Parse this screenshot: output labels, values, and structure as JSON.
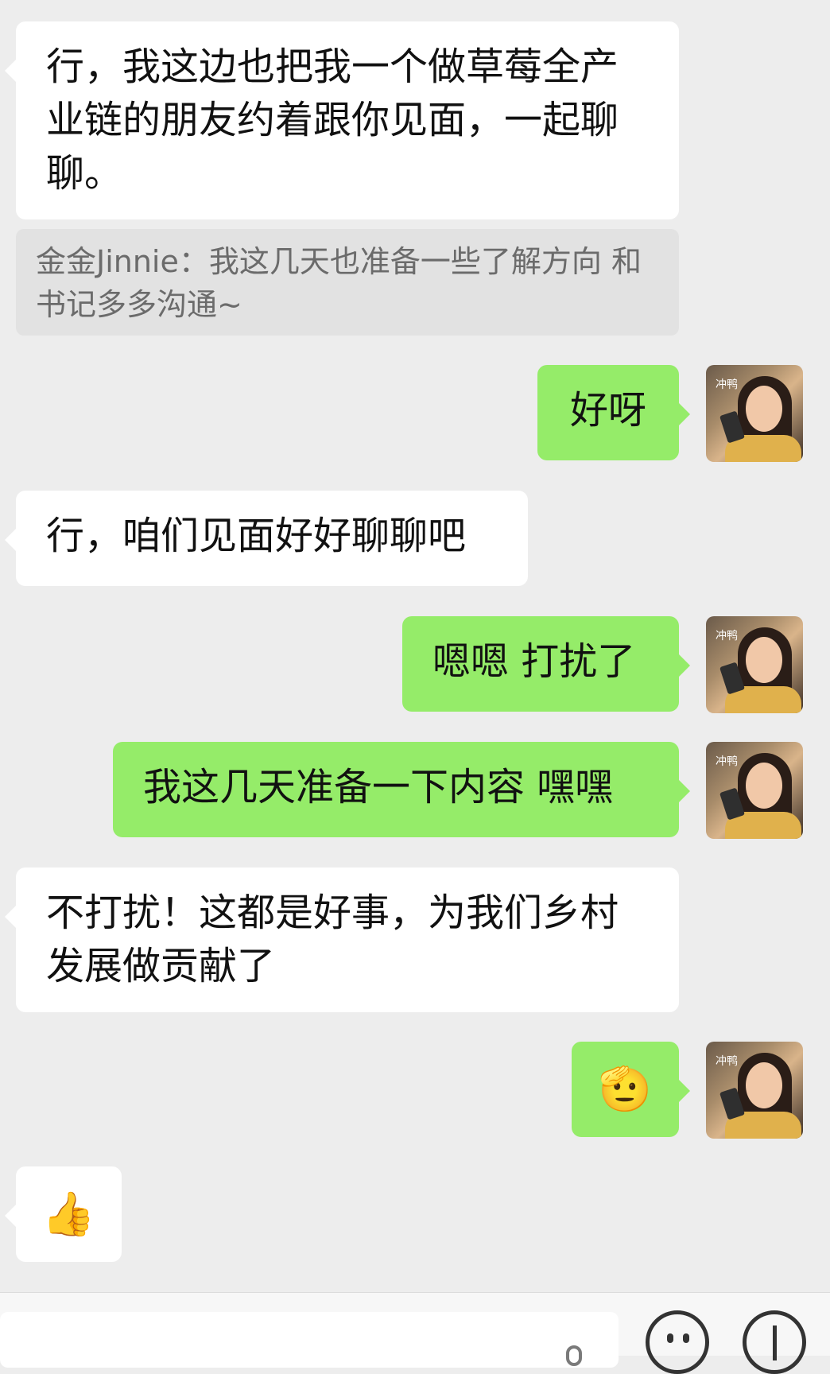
{
  "messages": [
    {
      "side": "left",
      "text": "行，我这边也把我一个做草莓全产业链的朋友约着跟你见面，一起聊聊。"
    },
    {
      "quote": "金金Jinnie：我这几天也准备一些了解方向 和书记多多沟通~"
    },
    {
      "side": "right",
      "text": "好呀"
    },
    {
      "side": "left",
      "text": "行，咱们见面好好聊聊吧"
    },
    {
      "side": "right",
      "text": "嗯嗯 打扰了"
    },
    {
      "side": "right",
      "text": "我这几天准备一下内容 嘿嘿"
    },
    {
      "side": "left",
      "text": "不打扰！这都是好事，为我们乡村发展做贡献了"
    },
    {
      "side": "right",
      "sticker": "🫡"
    },
    {
      "side": "left",
      "sticker": "👍"
    }
  ],
  "avatar": {
    "tag": "冲鸭"
  },
  "input_bar": {
    "voice_icon": "mic-icon",
    "emoji_icon": "smiley-icon",
    "plus_icon": "plus-icon"
  },
  "colors": {
    "background": "#ededed",
    "left_bubble": "#ffffff",
    "right_bubble": "#95ec69",
    "quote_bg": "#e2e2e2"
  }
}
